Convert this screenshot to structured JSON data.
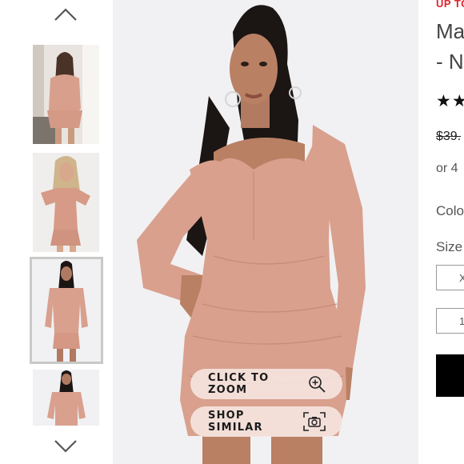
{
  "gallery": {
    "thumbnails": [
      {
        "alt": "model sitting in pink off-shoulder dress"
      },
      {
        "alt": "model posing in pink ruched dress"
      },
      {
        "alt": "model standing front view",
        "selected": true
      },
      {
        "alt": "model full length view"
      }
    ],
    "nav_up_icon": "chevron-up-icon",
    "nav_down_icon": "chevron-down-icon"
  },
  "main_image": {
    "zoom_label": "CLICK TO ZOOM",
    "zoom_icon": "zoom-in-icon",
    "similar_label": "SHOP SIMILAR",
    "similar_icon": "camera-search-icon"
  },
  "product": {
    "promo": "UP TO",
    "title_line1": "Ma",
    "title_line2": "- N",
    "stars": "★★",
    "price": "$39.",
    "installment": "or 4",
    "color_label": "Colo",
    "size_label": "Size",
    "size_options": [
      "X",
      "1"
    ]
  },
  "colors": {
    "promo_red": "#e0242e",
    "dress_pink": "#d9a08e",
    "pill_bg": "#f6e7e2",
    "thumb_border": "#c9c9c9"
  }
}
